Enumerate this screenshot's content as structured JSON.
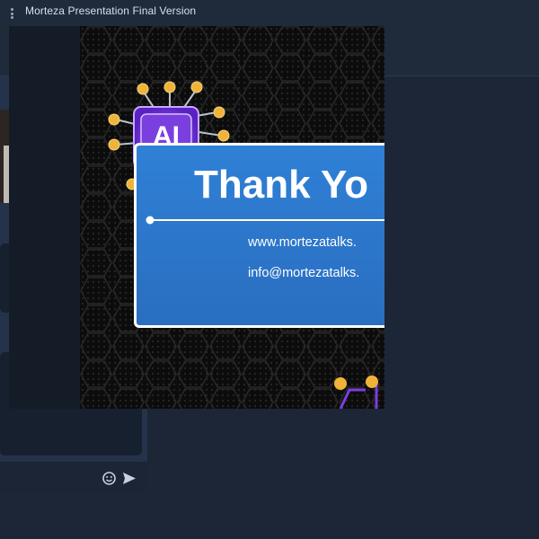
{
  "presentation": {
    "title": "Morteza Presentation Final Version",
    "slide": {
      "ai_badge": "AI",
      "heading": "Thank Yo",
      "website": "www.mortezatalks.",
      "email": "info@mortezatalks."
    }
  },
  "icons": {
    "video": "video-camera-icon",
    "people": "people-icon",
    "chat": "chat-icon",
    "emoji": "emoji-icon",
    "send": "send-icon",
    "menu": "kebab-menu-icon"
  },
  "colors": {
    "background": "#1c2636",
    "panel": "#24324a",
    "panel_inner": "#17202e",
    "slide_card": "#2f80d6",
    "ai_chip": "#7b3fe0",
    "circuit_node": "#f0b33a"
  }
}
